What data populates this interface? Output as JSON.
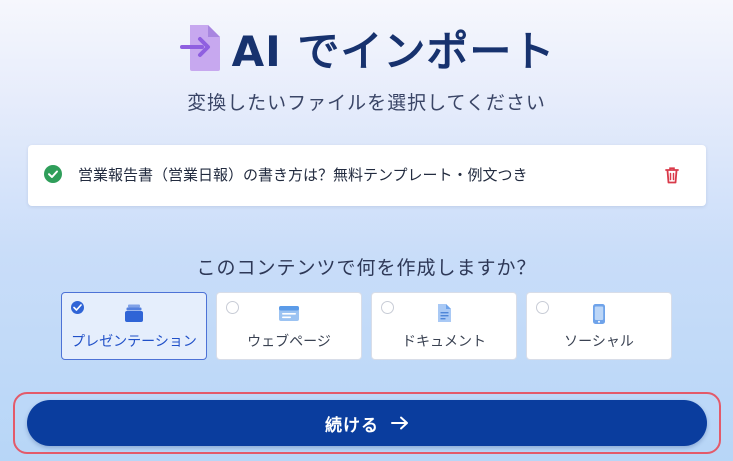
{
  "header": {
    "title": "AI でインポート",
    "subtitle": "変換したいファイルを選択してください",
    "icon": "file-import-icon"
  },
  "file": {
    "name": "営業報告書（営業日報）の書き方は？無料テンプレート・例文つき",
    "status_icon": "check-circle-icon",
    "delete_icon": "trash-icon",
    "status_color": "#2f9e5a",
    "delete_color": "#d93a4a"
  },
  "question": "このコンテンツで何を作成しますか？",
  "options": [
    {
      "label": "プレゼンテーション",
      "icon": "presentation-icon",
      "selected": true
    },
    {
      "label": "ウェブページ",
      "icon": "webpage-icon",
      "selected": false
    },
    {
      "label": "ドキュメント",
      "icon": "document-icon",
      "selected": false
    },
    {
      "label": "ソーシャル",
      "icon": "social-icon",
      "selected": false
    }
  ],
  "continue_button": {
    "label": "続ける",
    "icon": "arrow-right-icon"
  },
  "colors": {
    "accent": "#0a3d9e",
    "selected_option": "#2f64d6",
    "highlight_outline": "#e35a6a"
  }
}
